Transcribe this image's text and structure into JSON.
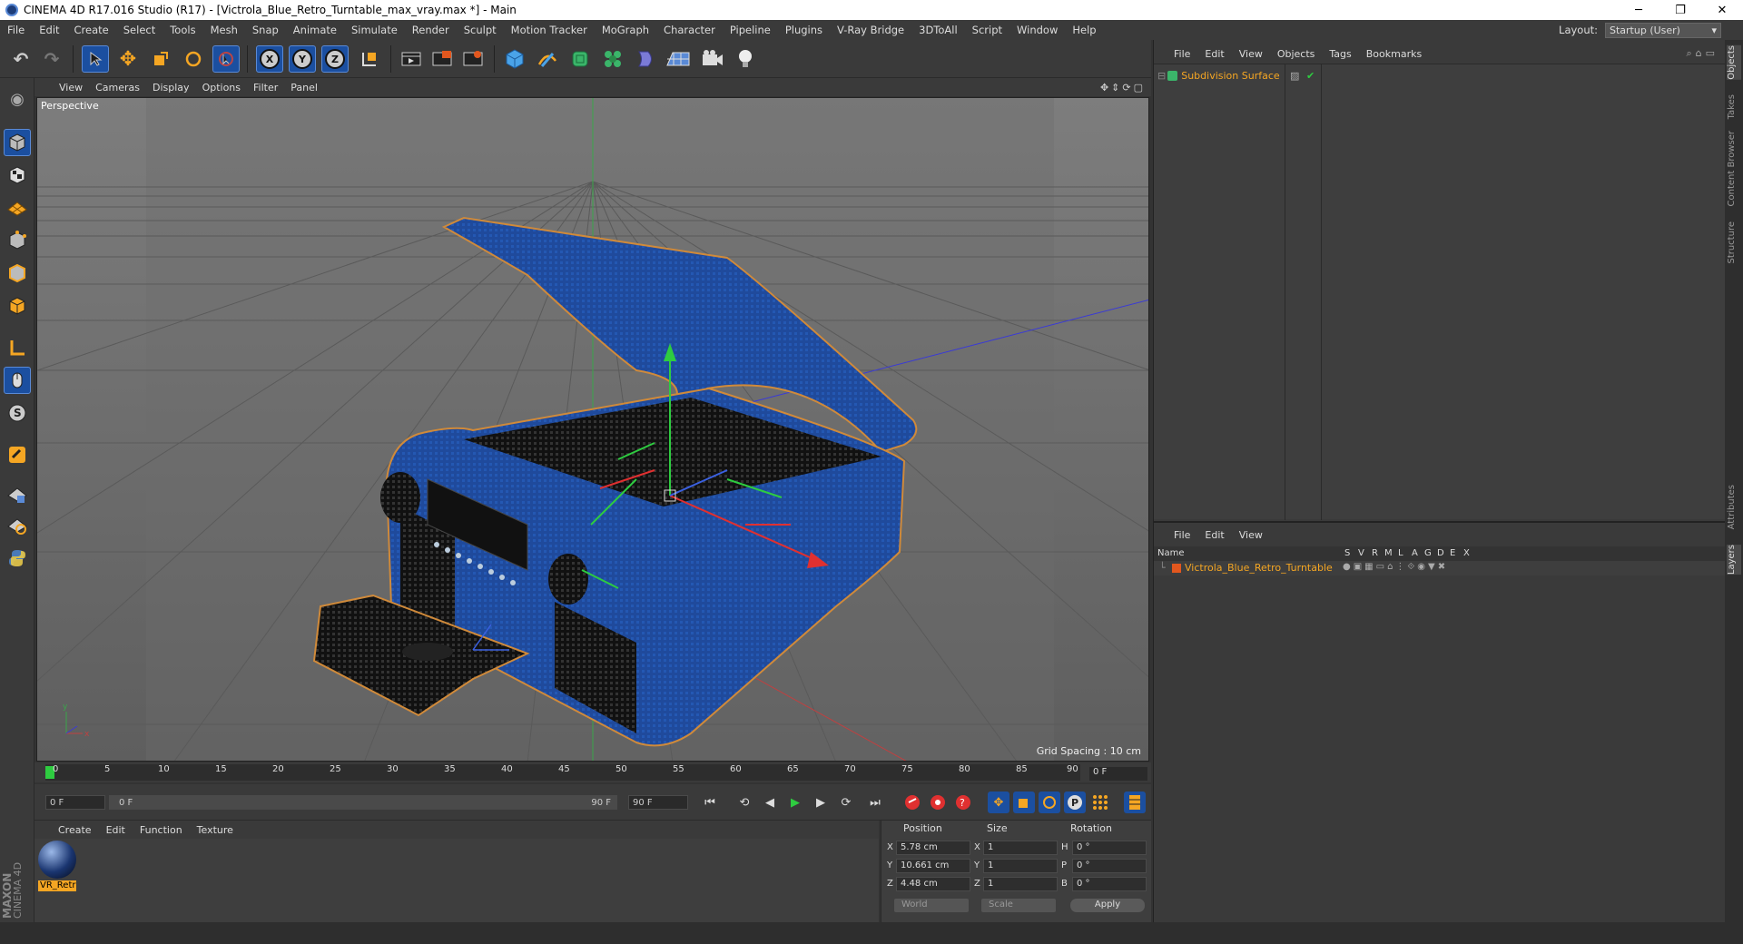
{
  "window": {
    "title": "CINEMA 4D R17.016 Studio (R17) - [Victrola_Blue_Retro_Turntable_max_vray.max *] - Main",
    "minimize": "─",
    "restore": "❐",
    "close": "✕"
  },
  "menubar": {
    "items": [
      "File",
      "Edit",
      "Create",
      "Select",
      "Tools",
      "Mesh",
      "Snap",
      "Animate",
      "Simulate",
      "Render",
      "Sculpt",
      "Motion Tracker",
      "MoGraph",
      "Character",
      "Pipeline",
      "Plugins",
      "V-Ray Bridge",
      "3DToAll",
      "Script",
      "Window",
      "Help"
    ],
    "layout_label": "Layout:",
    "layout_value": "Startup (User)"
  },
  "toolbar": {
    "axis_x": "X",
    "axis_y": "Y",
    "axis_z": "Z"
  },
  "viewport": {
    "menu": [
      "View",
      "Cameras",
      "Display",
      "Options",
      "Filter",
      "Panel"
    ],
    "label": "Perspective",
    "grid_spacing": "Grid Spacing : 10 cm"
  },
  "timeline": {
    "ticks": [
      "0",
      "5",
      "10",
      "15",
      "20",
      "25",
      "30",
      "35",
      "40",
      "45",
      "50",
      "55",
      "60",
      "65",
      "70",
      "75",
      "80",
      "85",
      "90"
    ],
    "current_frame": "0 F"
  },
  "playback": {
    "start": "0 F",
    "range_start": "0 F",
    "range_end": "90 F",
    "end": "90 F"
  },
  "material_manager": {
    "menu": [
      "Create",
      "Edit",
      "Function",
      "Texture"
    ],
    "material_name": "VR_Retr"
  },
  "brand": {
    "line1": "MAXON",
    "line2": "CINEMA 4D"
  },
  "coordinates": {
    "headers": {
      "position": "Position",
      "size": "Size",
      "rotation": "Rotation"
    },
    "rows": [
      {
        "axis": "X",
        "pos": "5.78 cm",
        "saxis": "X",
        "size": "1",
        "raxis": "H",
        "rot": "0 °"
      },
      {
        "axis": "Y",
        "pos": "10.661 cm",
        "saxis": "Y",
        "size": "1",
        "raxis": "P",
        "rot": "0 °"
      },
      {
        "axis": "Z",
        "pos": "4.48 cm",
        "saxis": "Z",
        "size": "1",
        "raxis": "B",
        "rot": "0 °"
      }
    ],
    "space": "World",
    "mode": "Scale",
    "apply": "Apply"
  },
  "objects_panel": {
    "menu": [
      "File",
      "Edit",
      "View",
      "Objects",
      "Tags",
      "Bookmarks"
    ],
    "object": "Subdivision Surface"
  },
  "layers_panel": {
    "menu": [
      "File",
      "Edit",
      "View"
    ],
    "columns": {
      "name": "Name",
      "s": "S",
      "v": "V",
      "r": "R",
      "m": "M",
      "l": "L",
      "a": "A",
      "g": "G",
      "d": "D",
      "e": "E",
      "x": "X"
    },
    "layer": "Victrola_Blue_Retro_Turntable"
  },
  "side_tabs": [
    "Objects",
    "Takes",
    "Content Browser",
    "Structure",
    "Attributes",
    "Layers"
  ],
  "colors": {
    "accent": "#f5a623",
    "selection_blue": "#1b4fa0",
    "viewport_bg": "#6b6b6b"
  }
}
